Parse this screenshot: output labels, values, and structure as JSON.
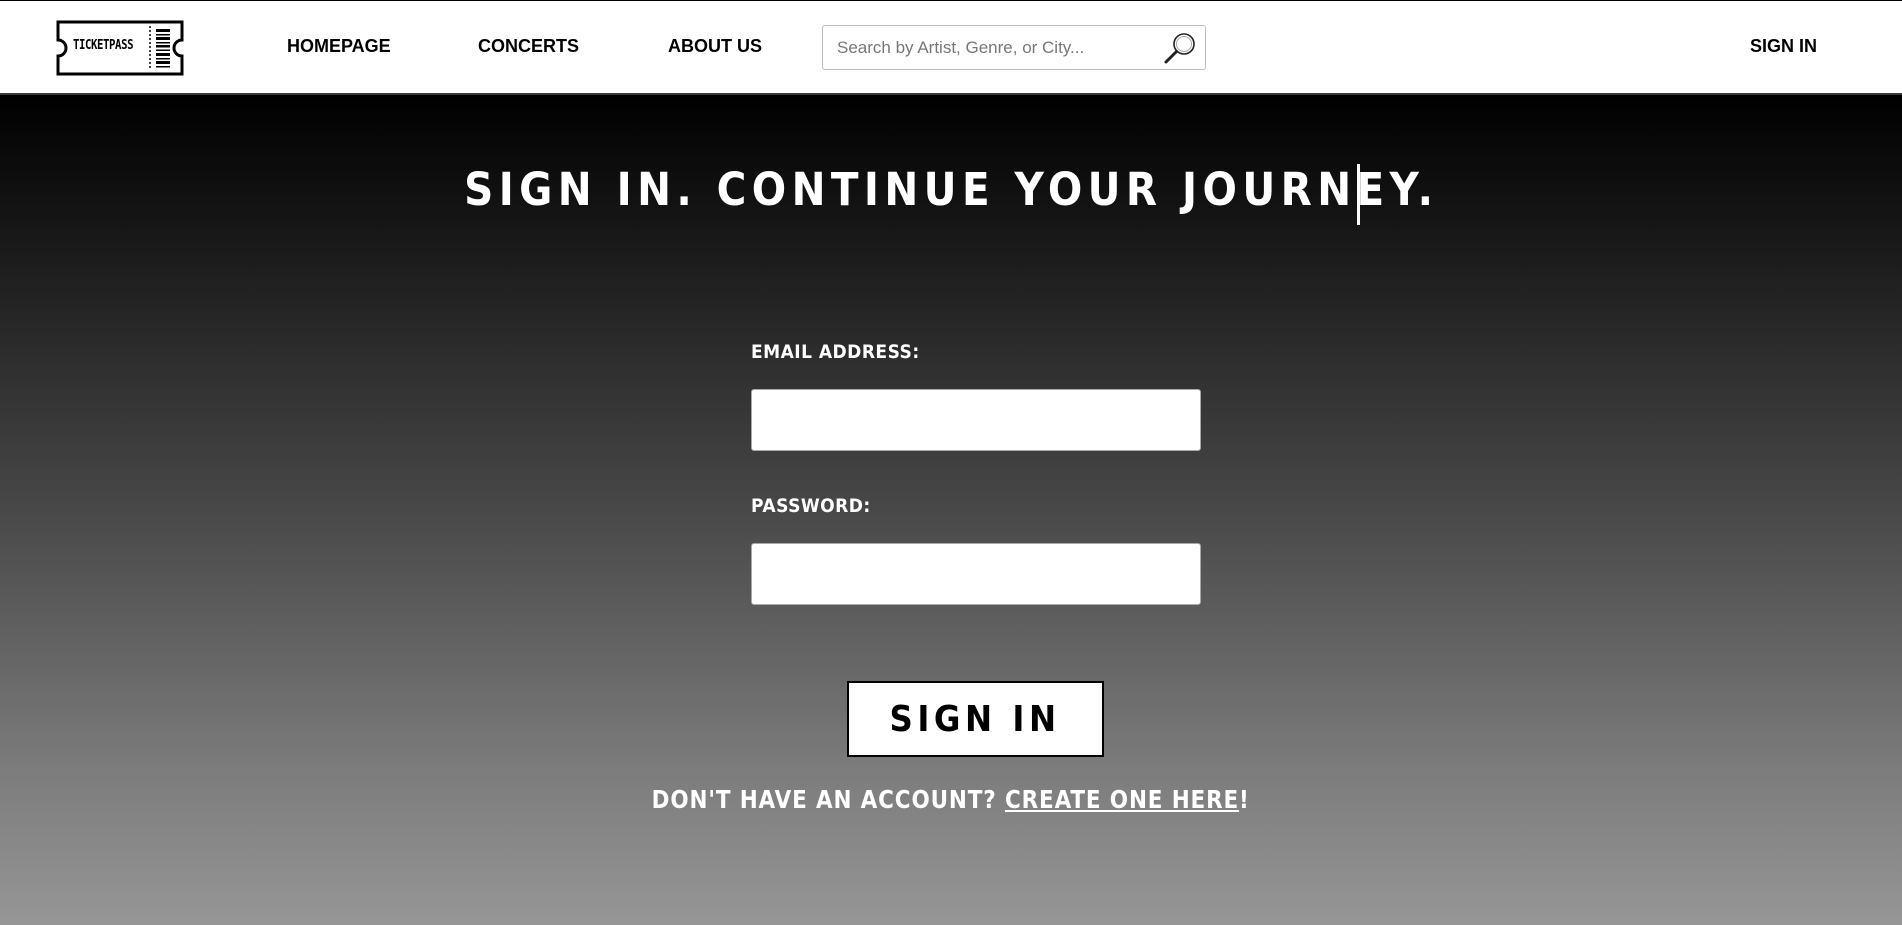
{
  "header": {
    "logo_text": "TICKETPASS",
    "nav": {
      "homepage": "HOMEPAGE",
      "concerts": "CONCERTS",
      "about": "ABOUT US",
      "signin": "SIGN IN"
    },
    "search": {
      "placeholder": "Search by Artist, Genre, or City...",
      "value": ""
    }
  },
  "main": {
    "title": "SIGN IN. CONTINUE YOUR JOURNEY.",
    "email_label": "EMAIL ADDRESS:",
    "email_value": "",
    "password_label": "PASSWORD:",
    "password_value": "",
    "submit_label": "SIGN IN",
    "account_prompt": "DON'T HAVE AN ACCOUNT? ",
    "create_link": "CREATE ONE HERE",
    "account_suffix": "!"
  },
  "colors": {
    "nav_background": "#ffffff",
    "gradient_top": "#000000",
    "gradient_bottom": "#979697",
    "text_light": "#ffffff",
    "text_dark": "#000000"
  },
  "icons": {
    "logo": "ticket-logo-icon",
    "search": "magnifier-icon"
  }
}
